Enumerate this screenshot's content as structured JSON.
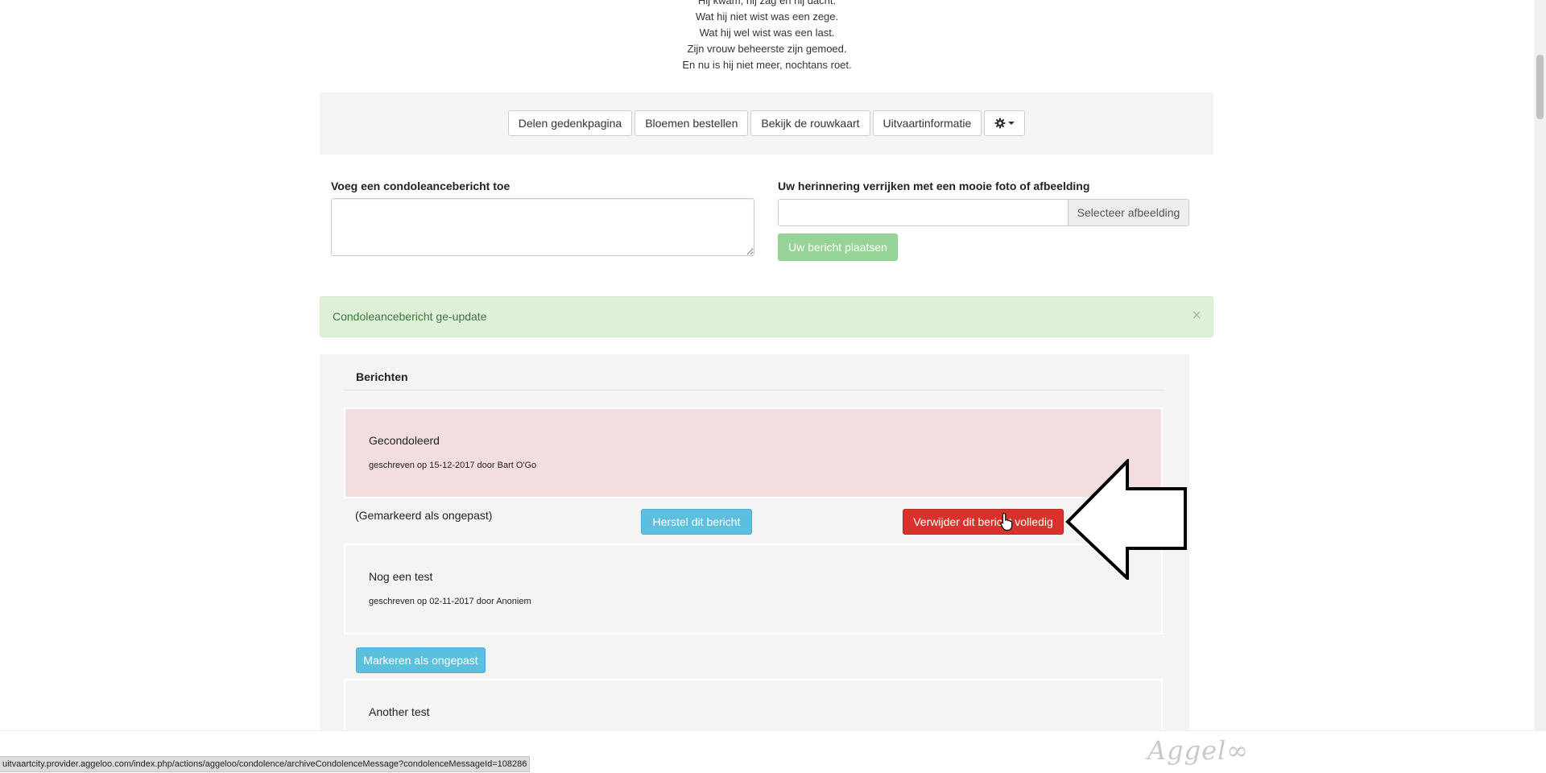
{
  "poem": {
    "lines": [
      "Hij kwam, hij zag en hij dacht.",
      "Wat hij niet wist was een zege.",
      "Wat hij wel wist was een last.",
      "Zijn vrouw beheerste zijn gemoed.",
      "En nu is hij niet meer, nochtans roet."
    ]
  },
  "actions": {
    "share": "Delen gedenkpagina",
    "flowers": "Bloemen bestellen",
    "card": "Bekijk de rouwkaart",
    "info": "Uitvaartinformatie",
    "settings_icon": "gear-icon"
  },
  "form": {
    "condolence_label": "Voeg een condoleancebericht toe",
    "condolence_value": "",
    "photo_label": "Uw herinnering verrijken met een mooie foto of afbeelding",
    "photo_value": "",
    "select_image": "Selecteer afbeelding",
    "post": "Uw bericht plaatsen"
  },
  "alert": {
    "text": "Condoleancebericht ge-update",
    "close": "×"
  },
  "messages": {
    "heading": "Berichten",
    "items": [
      {
        "title": "Gecondoleerd",
        "meta": "geschreven op 15-12-2017 door Bart O'Go",
        "status": "(Gemarkeerd als ongepast)",
        "restore": "Herstel dit bericht",
        "delete": "Verwijder dit bericht volledig"
      },
      {
        "title": "Nog een test",
        "meta": "geschreven op 02-11-2017 door Anoniem",
        "flag": "Markeren als ongepast"
      },
      {
        "title": "Another test"
      }
    ]
  },
  "footer": {
    "brand": "Aggel∞",
    "status_url": "uitvaartcity.provider.aggeloo.com/index.php/actions/aggeloo/condolence/archiveCondolenceMessage?condolenceMessageId=108286"
  },
  "colors": {
    "success_bg": "#dff0d8",
    "flagged_bg": "#f2dede",
    "info": "#5bc0de",
    "danger": "#d9322c",
    "post_disabled": "#96d396"
  }
}
